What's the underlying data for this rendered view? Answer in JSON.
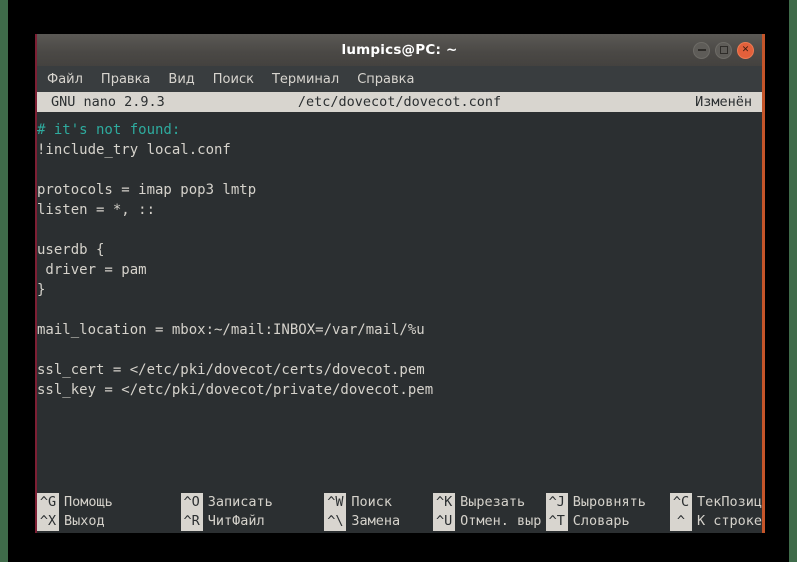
{
  "window": {
    "title": "lumpics@PC: ~",
    "controls": [
      {
        "name": "minimize",
        "glyph": "dash"
      },
      {
        "name": "maximize",
        "glyph": "square"
      },
      {
        "name": "close",
        "glyph": "✕"
      }
    ]
  },
  "menubar": {
    "items": [
      {
        "label": "Файл"
      },
      {
        "label": "Правка"
      },
      {
        "label": "Вид"
      },
      {
        "label": "Поиск"
      },
      {
        "label": "Терминал"
      },
      {
        "label": "Справка"
      }
    ]
  },
  "nano_header": {
    "version": "GNU nano 2.9.3",
    "filename": "/etc/dovecot/dovecot.conf",
    "state": "Изменён"
  },
  "editor": {
    "lines": [
      {
        "text": "# it's not found:",
        "type": "comment"
      },
      {
        "text": "!include_try local.conf",
        "type": "normal"
      },
      {
        "text": "",
        "type": "blank"
      },
      {
        "text": "protocols = imap pop3 lmtp",
        "type": "normal"
      },
      {
        "text": "listen = *, ::",
        "type": "normal"
      },
      {
        "text": "",
        "type": "blank"
      },
      {
        "text": "userdb {",
        "type": "normal"
      },
      {
        "text": " driver = pam",
        "type": "normal"
      },
      {
        "text": "}",
        "type": "normal"
      },
      {
        "text": "",
        "type": "blank"
      },
      {
        "text": "mail_location = mbox:~/mail:INBOX=/var/mail/%u",
        "type": "normal"
      },
      {
        "text": "",
        "type": "blank"
      },
      {
        "text": "ssl_cert = </etc/pki/dovecot/certs/dovecot.pem",
        "type": "normal"
      },
      {
        "text": "ssl_key = </etc/pki/dovecot/private/dovecot.pem",
        "type": "normal"
      }
    ]
  },
  "shortcuts": {
    "row1": [
      {
        "key": "^G",
        "label": "Помощь"
      },
      {
        "key": "^O",
        "label": "Записать"
      },
      {
        "key": "^W",
        "label": "Поиск"
      },
      {
        "key": "^K",
        "label": "Вырезать"
      },
      {
        "key": "^J",
        "label": "Выровнять"
      },
      {
        "key": "^C",
        "label": "ТекПозиц"
      }
    ],
    "row2": [
      {
        "key": "^X",
        "label": "Выход"
      },
      {
        "key": "^R",
        "label": "ЧитФайл"
      },
      {
        "key": "^\\",
        "label": "Замена"
      },
      {
        "key": "^U",
        "label": "Отмен. выр"
      },
      {
        "key": "^T",
        "label": "Словарь"
      },
      {
        "key": "^",
        "label": "К строке"
      }
    ]
  },
  "colors": {
    "terminal_bg": "#2b2f31",
    "terminal_fg": "#d5d2cb",
    "comment": "#2eab9e",
    "inverted_bg": "#d8d5cf",
    "titlebar": "#4b4946",
    "close_button": "#e2603b",
    "border_left": "#7d1f34",
    "border_right": "#c4552a",
    "edge_strip": "#3f6b4a"
  }
}
